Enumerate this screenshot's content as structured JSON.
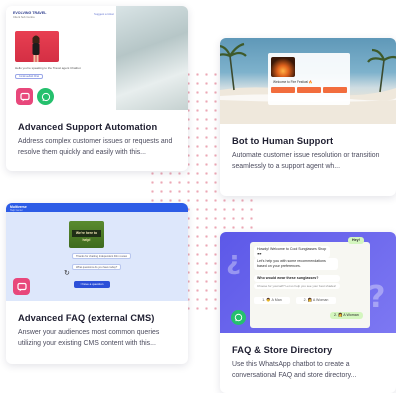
{
  "cards": [
    {
      "title": "Advanced Support Automation",
      "desc": "Address complex customer issues or requests and resolve them quickly and easily with this...",
      "thumb": {
        "brand": "EVOLVING TRAVEL",
        "brand_sub": "Client hub Centre",
        "top_link": "Suggest a ticket",
        "message": "Hello you're speaking to the Travel agent Chatbot",
        "button": "Continue/Exit Chat"
      }
    },
    {
      "title": "Bot to Human Support",
      "desc": "Automate customer issue resolution or transition seamlessly to a support agent wh...",
      "thumb": {
        "overlay_text": "Welcome to Fire Festival 🔥"
      }
    },
    {
      "title": "Advanced FAQ (external CMS)",
      "desc": "Answer your audiences most common queries utilizing your existing CMS content with this...",
      "thumb": {
        "brand": "Multiverse",
        "brand_sub": "Help Center",
        "image_label": "We're here to help!",
        "chip1": "Thanks for chatting Independent Film review",
        "chip2": "What questions do you have today?",
        "cta": "I have a question"
      }
    },
    {
      "title": "FAQ & Store Directory",
      "desc": "Use this WhatsApp chatbot to create a conversational FAQ and store directory...",
      "thumb": {
        "hey": "Hey!",
        "welcome": "Howdy! Welcome to Cool Sunglasses Shop 🕶",
        "help": "Let's help you with some recommendations based on your preferences.",
        "question": "Who would wear these sunglasses?",
        "question_sub": "Choose for yourself? Let us help you see your best shades!",
        "opt1": "1. 👨 A Man",
        "opt2": "2. 👩 A Woman",
        "answer": "2. 👩 A Woman"
      }
    }
  ],
  "colors": {
    "pink_icon": "#e8477b",
    "whatsapp_green": "#25c06d",
    "faq_blue": "#2d5ce6",
    "purple_bg": "#5c58e8"
  }
}
